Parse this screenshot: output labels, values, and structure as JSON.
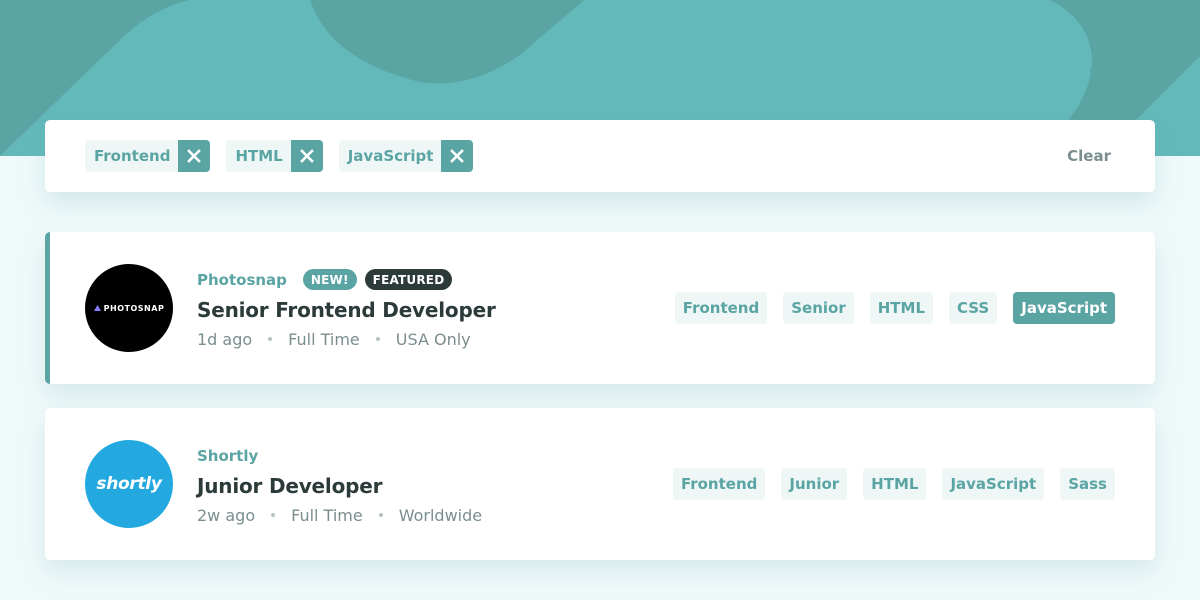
{
  "colors": {
    "primary": "#5ba4a4",
    "dark": "#2c3a3a",
    "muted": "#7b8e8e",
    "background": "#eff9fa",
    "tag_bg": "#eef6f6"
  },
  "filter_bar": {
    "filters": [
      "Frontend",
      "HTML",
      "JavaScript"
    ],
    "clear_label": "Clear",
    "remove_icon": "close-icon"
  },
  "jobs": [
    {
      "company": "Photosnap",
      "logo_text": "PHOTOSNAP",
      "new_label": "NEW!",
      "featured_label": "FEATURED",
      "position": "Senior Frontend Developer",
      "posted_at": "1d ago",
      "contract": "Full Time",
      "location": "USA Only",
      "tags": [
        "Frontend",
        "Senior",
        "HTML",
        "CSS",
        "JavaScript"
      ],
      "highlighted_tag": "JavaScript"
    },
    {
      "company": "Shortly",
      "logo_text": "shortly",
      "position": "Junior Developer",
      "posted_at": "2w ago",
      "contract": "Full Time",
      "location": "Worldwide",
      "tags": [
        "Frontend",
        "Junior",
        "HTML",
        "JavaScript",
        "Sass"
      ]
    }
  ]
}
